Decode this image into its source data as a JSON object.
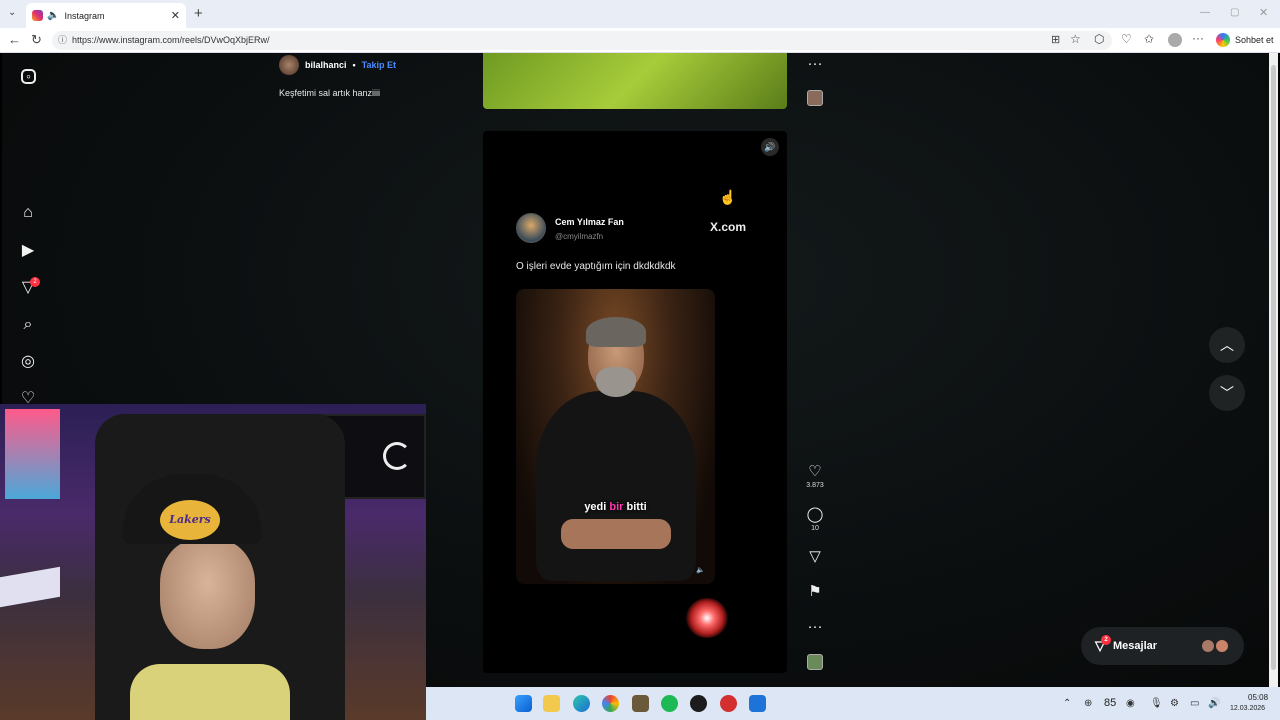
{
  "browser": {
    "tab_title": "Instagram",
    "tab_close": "✕",
    "new_tab": "+",
    "url": "https://www.instagram.com/reels/DVwOqXbjERw/",
    "copilot_label": "Sohbet et"
  },
  "prev_post": {
    "author": "bilalhanci",
    "separator": "•",
    "follow_label": "Takip Et",
    "caption": "Keşfetimi sal artık hanziiii"
  },
  "nav": {
    "messages_badge": "2"
  },
  "reel": {
    "tweet_name": "Cem Yılmaz Fan",
    "tweet_handle": "@cmyilmazfn",
    "xcom_label": "X.com",
    "tweet_text": "O işleri evde yaptığım için dkdkdkdk",
    "subtitle_a": "yedi ",
    "subtitle_b": "bir ",
    "subtitle_c": "bitti"
  },
  "actions": {
    "likes": "3.873",
    "comments": "10",
    "more": "···"
  },
  "messages": {
    "label": "Mesajlar",
    "badge": "2"
  },
  "webcam": {
    "cap_text": "Lakers"
  },
  "taskbar": {
    "tray_number": "85",
    "time": "05:08",
    "date": "12.03.2026"
  }
}
